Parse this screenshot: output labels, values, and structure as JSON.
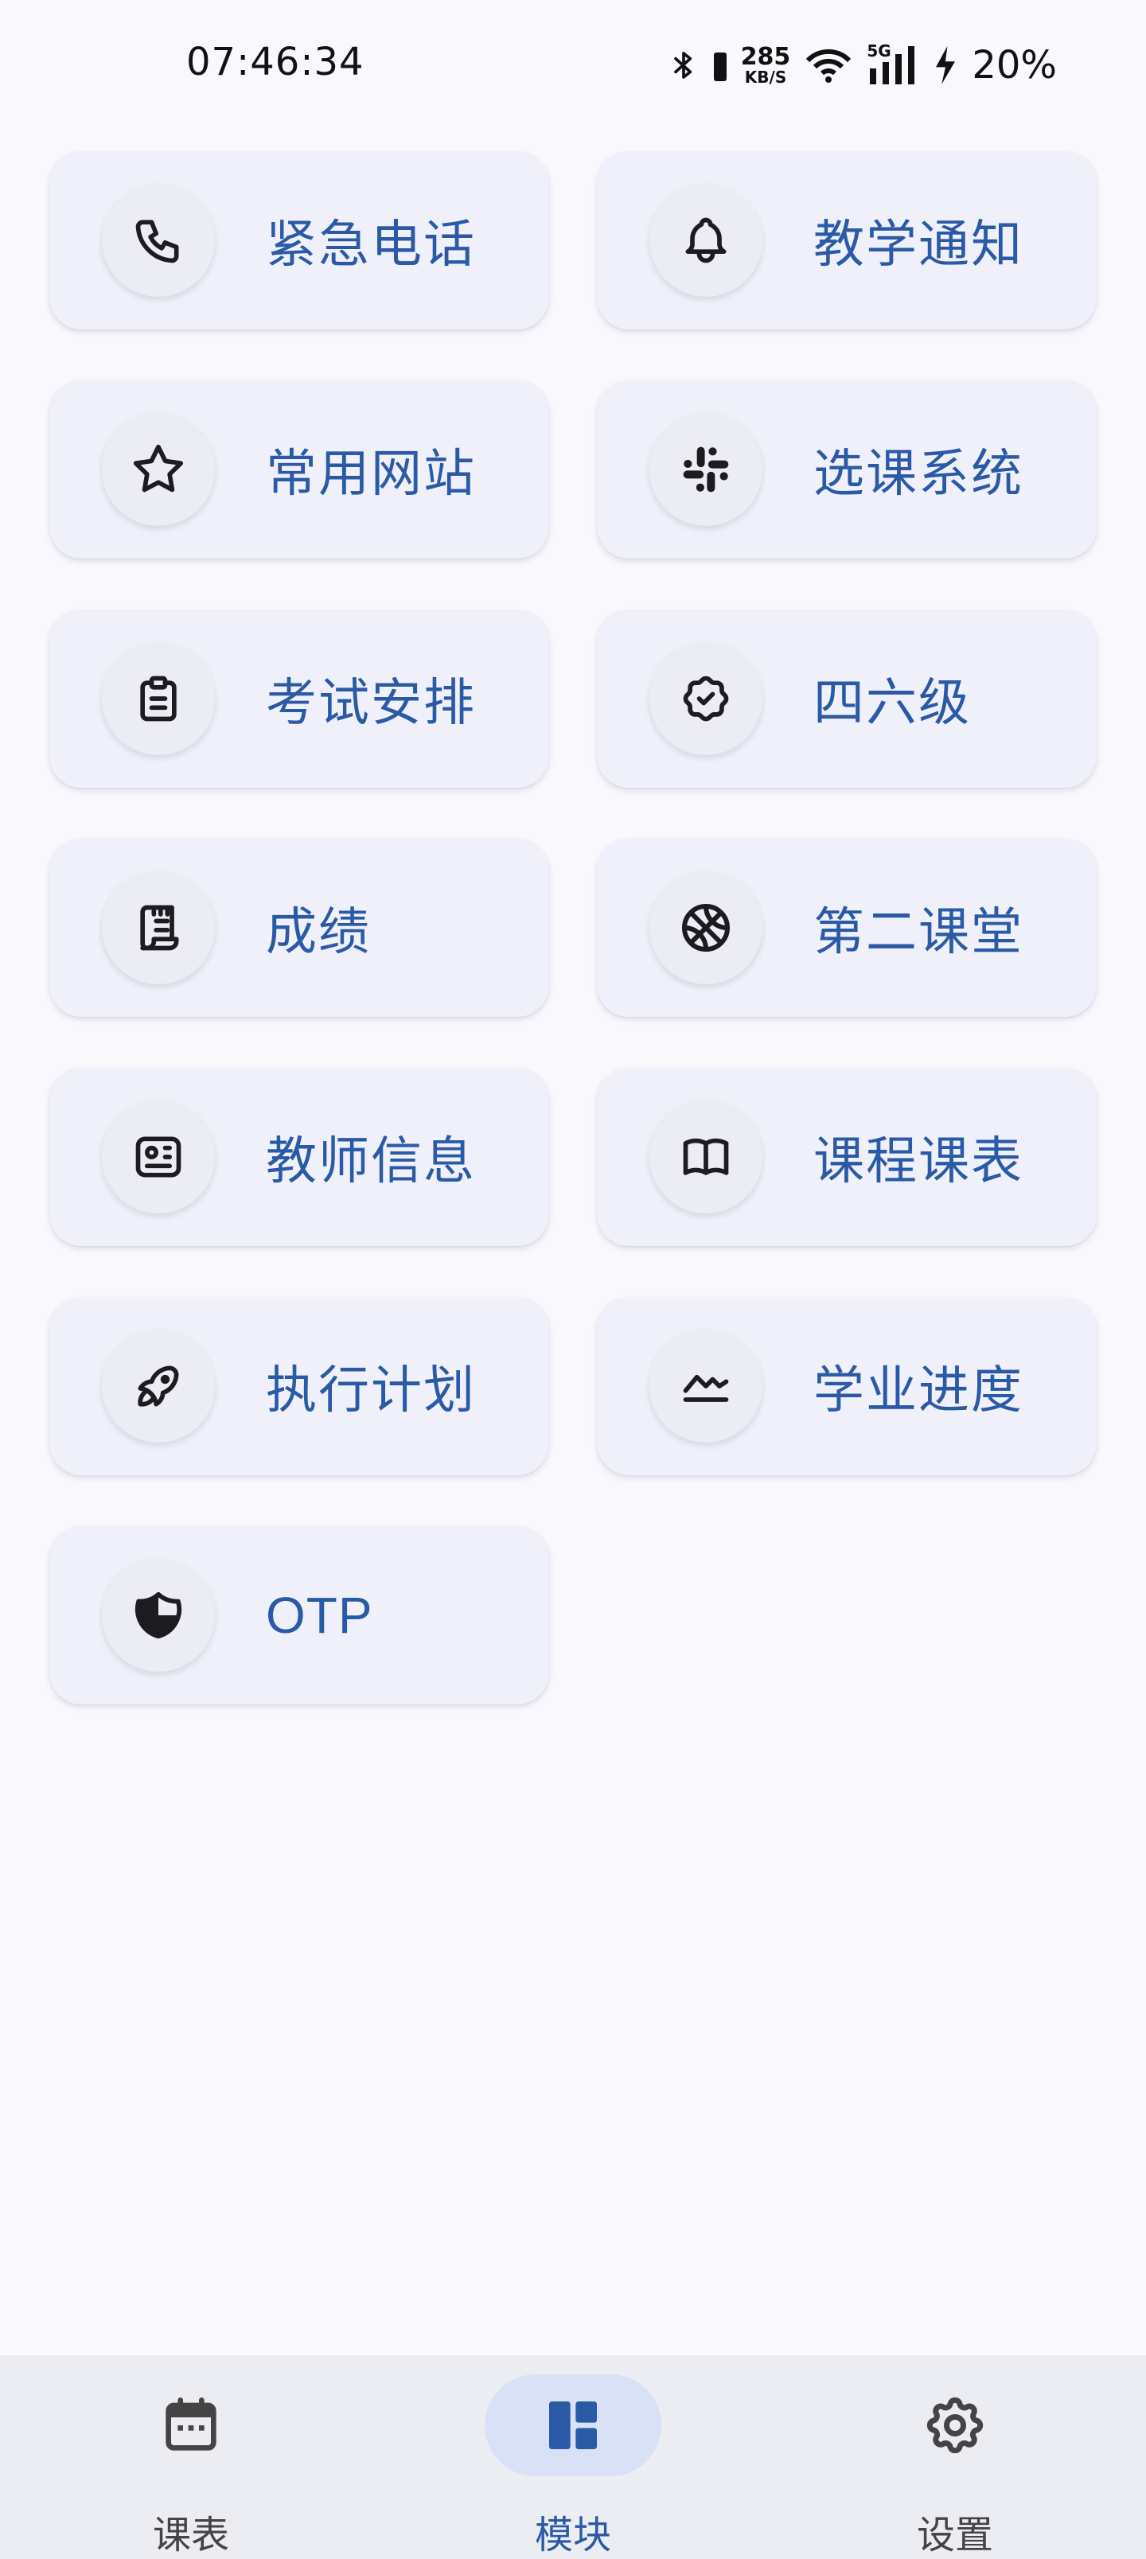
{
  "status_bar": {
    "time": "07:46:34",
    "net_speed": "285",
    "net_unit": "KB/S",
    "network_type": "5G",
    "battery": "20%"
  },
  "modules": [
    {
      "id": "emergency",
      "label": "紧急电话",
      "icon": "phone-icon"
    },
    {
      "id": "notice",
      "label": "教学通知",
      "icon": "bell-icon"
    },
    {
      "id": "websites",
      "label": "常用网站",
      "icon": "star-icon"
    },
    {
      "id": "course-selection",
      "label": "选课系统",
      "icon": "hash-grid-icon"
    },
    {
      "id": "exams",
      "label": "考试安排",
      "icon": "clipboard-icon"
    },
    {
      "id": "cet",
      "label": "四六级",
      "icon": "badge-check-icon"
    },
    {
      "id": "grades",
      "label": "成绩",
      "icon": "receipt-icon"
    },
    {
      "id": "second-classroom",
      "label": "第二课堂",
      "icon": "basketball-icon"
    },
    {
      "id": "teachers",
      "label": "教师信息",
      "icon": "id-card-icon"
    },
    {
      "id": "course-table",
      "label": "课程课表",
      "icon": "book-icon"
    },
    {
      "id": "plan",
      "label": "执行计划",
      "icon": "rocket-icon"
    },
    {
      "id": "progress",
      "label": "学业进度",
      "icon": "chart-line-icon"
    },
    {
      "id": "otp",
      "label": "OTP",
      "icon": "shield-icon"
    }
  ],
  "bottom_nav": [
    {
      "label": "课表",
      "icon": "calendar-icon",
      "active": false
    },
    {
      "label": "模块",
      "icon": "dashboard-icon",
      "active": true
    },
    {
      "label": "设置",
      "icon": "gear-icon",
      "active": false
    }
  ],
  "colors": {
    "background": "#f8f8fd",
    "card": "#f0f0fa",
    "accent": "#2a5aa6",
    "nav_active_pill": "#d9e1f7"
  }
}
